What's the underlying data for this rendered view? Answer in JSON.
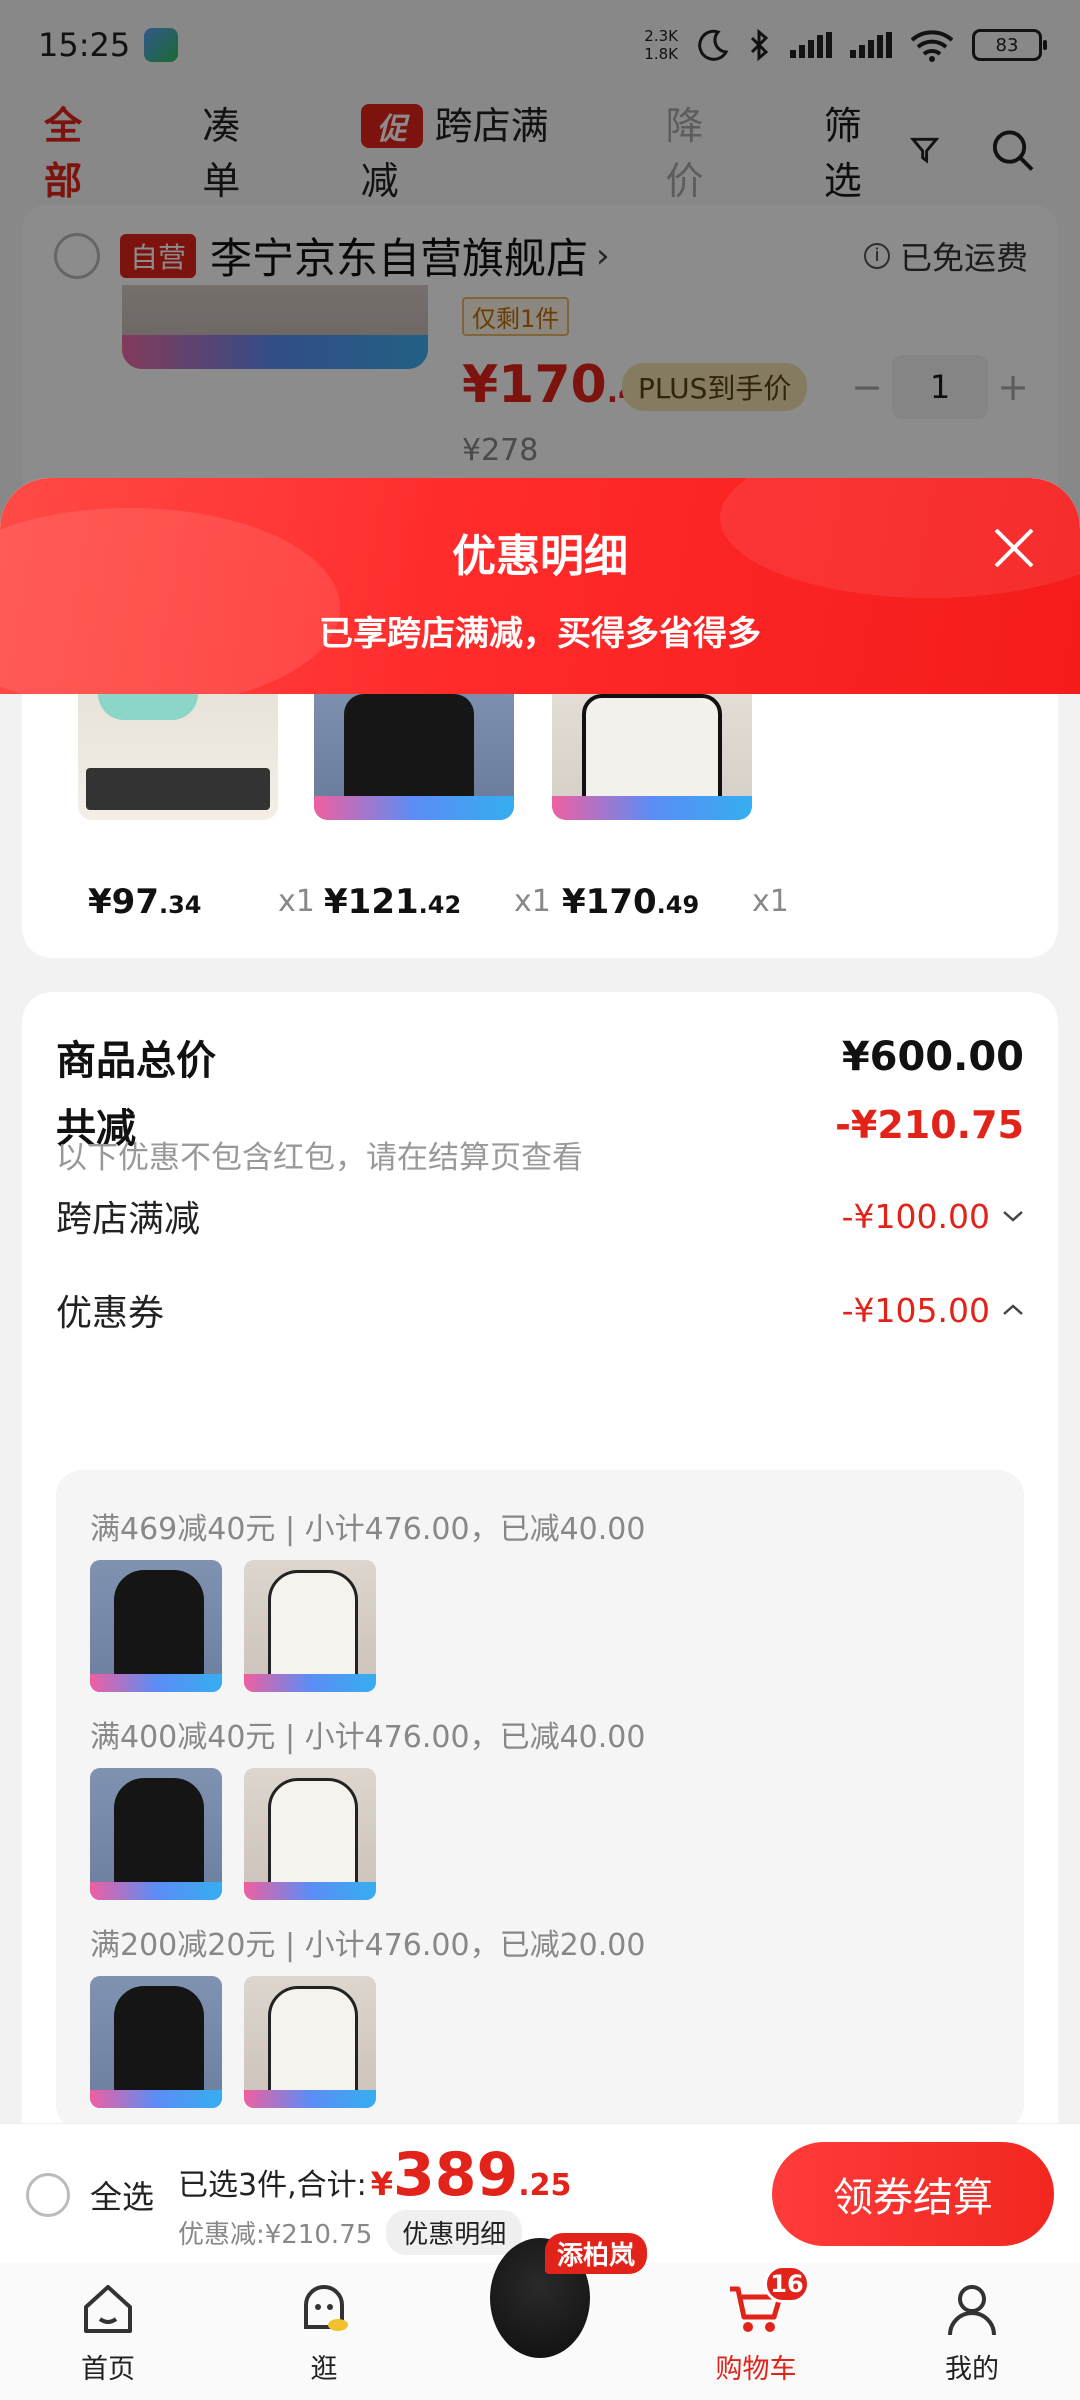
{
  "status_bar": {
    "time": "15:25",
    "net_speed_up": "2.3K",
    "net_speed_down": "1.8K",
    "battery": "83"
  },
  "top_tabs": {
    "all": "全部",
    "bundle": "凑单",
    "promo_tag": "促",
    "cross_store": "跨店满减",
    "price_drop": "降价",
    "filter": "筛选"
  },
  "store": {
    "self_tag": "自营",
    "name": "李宁京东自营旗舰店",
    "chevron": "›",
    "shipping": "已免运费",
    "stock_tag": "仅剩1件",
    "price_int": "¥170",
    "price_dec": ".49",
    "plus_tag": "PLUS到手价",
    "qty": "1",
    "qty_minus": "−",
    "qty_plus": "+",
    "orig_price": "¥278"
  },
  "sheet": {
    "title": "优惠明细",
    "subtitle": "已享跨店满减，买得多省得多"
  },
  "items": [
    {
      "price_int": "¥97",
      "price_dec": ".34",
      "qty": "x1"
    },
    {
      "price_int": "¥121",
      "price_dec": ".42",
      "qty": "x1"
    },
    {
      "price_int": "¥170",
      "price_dec": ".49",
      "qty": "x1"
    }
  ],
  "summary": {
    "total_label": "商品总价",
    "total_value": "¥600.00",
    "discount_label": "共减",
    "discount_value": "-¥210.75",
    "discount_note": "以下优惠不包含红包，请在结算页查看",
    "cross_store_label": "跨店满减",
    "cross_store_value": "-¥100.00",
    "coupon_label": "优惠券",
    "coupon_value": "-¥105.00"
  },
  "coupons": [
    {
      "text": "满469减40元 | 小计476.00，已减40.00"
    },
    {
      "text": "满400减40元 | 小计476.00，已减40.00"
    },
    {
      "text": "满200减20元 | 小计476.00，已减20.00"
    }
  ],
  "checkout": {
    "select_all": "全选",
    "selected_text": "已选3件,合计:",
    "total_yen": "¥",
    "total_int": "389",
    "total_dec": ".25",
    "discount_text": "优惠减:¥210.75",
    "detail_chip": "优惠明细",
    "checkout_button": "领券结算"
  },
  "tab_bar": {
    "home": "首页",
    "browse": "逛",
    "promo_badge": "添柏岚",
    "cart": "购物车",
    "cart_count": "16",
    "mine": "我的"
  },
  "colors": {
    "accent_red": "#e2231a",
    "header_red": "#ff2a2a"
  }
}
